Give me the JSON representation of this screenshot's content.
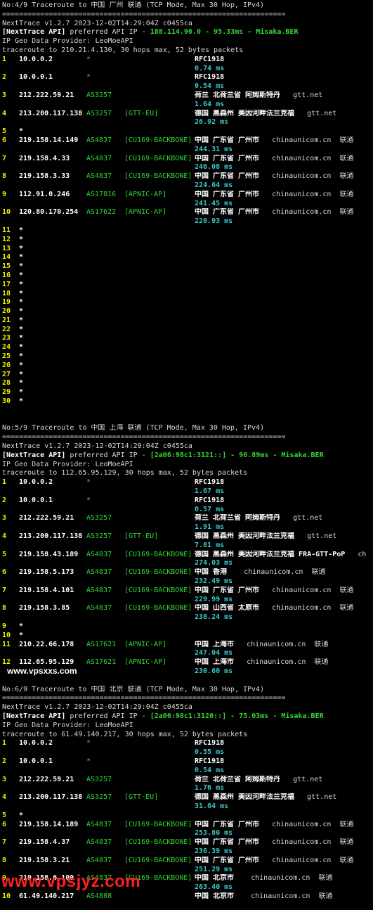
{
  "watermark_top": "www.vpsxxs.com",
  "watermark_bottom": "www.vpsjyz.com",
  "sections": [
    {
      "title": "No:4/9 Traceroute to 中国 广州 联通 (TCP Mode, Max 30 Hop, IPv4)",
      "separator": "===================================================================",
      "version": "NextTrace v1.2.7 2023-12-02T14:29:04Z c0455ca",
      "api_prefix": "[NextTrace API]",
      "api_mid": " preferred API IP - ",
      "api_ip": "188.114.96.0",
      "api_rtt": " - 95.33ms - ",
      "api_node": "Misaka.BER",
      "geo_provider": "IP Geo Data Provider: LeoMoeAPI",
      "trace_line": "traceroute to 210.21.4.130, 30 hops max, 52 bytes packets",
      "hops": [
        {
          "n": "1",
          "ip": "10.0.0.2",
          "as": "*",
          "tag": "",
          "geo": "RFC1918",
          "dom": "",
          "rtt": "0.74 ms"
        },
        {
          "n": "2",
          "ip": "10.0.0.1",
          "as": "*",
          "tag": "",
          "geo": "RFC1918",
          "dom": "",
          "rtt": "0.54 ms"
        },
        {
          "n": "3",
          "ip": "212.222.59.21",
          "as": "AS3257",
          "tag": "",
          "geo": "荷兰 北荷兰省 阿姆斯特丹",
          "dom": "gtt.net",
          "rtt": "1.64 ms"
        },
        {
          "n": "4",
          "ip": "213.200.117.138",
          "as": "AS3257",
          "tag": "[GTT-EU]",
          "geo": "德国 黑森州 美因河畔法兰克福",
          "dom": "gtt.net",
          "rtt": "26.92 ms"
        },
        {
          "n": "5",
          "ip": "*",
          "as": "",
          "tag": "",
          "geo": "",
          "dom": "",
          "rtt": ""
        },
        {
          "n": "6",
          "ip": "219.158.14.149",
          "as": "AS4837",
          "tag": "[CU169-BACKBONE]",
          "geo": "中国 广东省 广州市",
          "dom": "chinaunicom.cn  联通",
          "rtt": "244.31 ms"
        },
        {
          "n": "7",
          "ip": "219.158.4.33",
          "as": "AS4837",
          "tag": "[CU169-BACKBONE]",
          "geo": "中国 广东省 广州市",
          "dom": "chinaunicom.cn  联通",
          "rtt": "246.08 ms"
        },
        {
          "n": "8",
          "ip": "219.158.3.33",
          "as": "AS4837",
          "tag": "[CU169-BACKBONE]",
          "geo": "中国 广东省 广州市",
          "dom": "chinaunicom.cn  联通",
          "rtt": "224.64 ms"
        },
        {
          "n": "9",
          "ip": "112.91.0.246",
          "as": "AS17816",
          "tag": "[APNIC-AP]",
          "geo": "中国 广东省 广州市",
          "dom": "chinaunicom.cn  联通",
          "rtt": "241.45 ms"
        },
        {
          "n": "10",
          "ip": "120.80.170.254",
          "as": "AS17622",
          "tag": "[APNIC-AP]",
          "geo": "中国 广东省 广州市",
          "dom": "chinaunicom.cn  联通",
          "rtt": "220.93 ms"
        }
      ],
      "star_hops": [
        "11",
        "12",
        "13",
        "14",
        "15",
        "16",
        "17",
        "18",
        "19",
        "20",
        "21",
        "22",
        "23",
        "24",
        "25",
        "26",
        "27",
        "28",
        "29",
        "30"
      ]
    },
    {
      "title": "No:5/9 Traceroute to 中国 上海 联通 (TCP Mode, Max 30 Hop, IPv4)",
      "separator": "===================================================================",
      "version": "NextTrace v1.2.7 2023-12-02T14:29:04Z c0455ca",
      "api_prefix": "[NextTrace API]",
      "api_mid": " preferred API IP - ",
      "api_ip": "[2a06:98c1:3121::]",
      "api_rtt": " - 96.89ms - ",
      "api_node": "Misaka.BER",
      "geo_provider": "IP Geo Data Provider: LeoMoeAPI",
      "trace_line": "traceroute to 112.65.95.129, 30 hops max, 52 bytes packets",
      "hops": [
        {
          "n": "1",
          "ip": "10.0.0.2",
          "as": "*",
          "tag": "",
          "geo": "RFC1918",
          "dom": "",
          "rtt": "1.67 ms"
        },
        {
          "n": "2",
          "ip": "10.0.0.1",
          "as": "*",
          "tag": "",
          "geo": "RFC1918",
          "dom": "",
          "rtt": "0.57 ms"
        },
        {
          "n": "3",
          "ip": "212.222.59.21",
          "as": "AS3257",
          "tag": "",
          "geo": "荷兰 北荷兰省 阿姆斯特丹",
          "dom": "gtt.net",
          "rtt": "1.91 ms"
        },
        {
          "n": "4",
          "ip": "213.200.117.138",
          "as": "AS3257",
          "tag": "[GTT-EU]",
          "geo": "德国 黑森州 美因河畔法兰克福",
          "dom": "gtt.net",
          "rtt": "7.81 ms"
        },
        {
          "n": "5",
          "ip": "219.158.43.189",
          "as": "AS4837",
          "tag": "[CU169-BACKBONE]",
          "geo": "德国 黑森州 美因河畔法兰克福 FRA-GTT-PoP",
          "dom": "ch",
          "rtt": "274.03 ms"
        },
        {
          "n": "6",
          "ip": "219.158.5.173",
          "as": "AS4837",
          "tag": "[CU169-BACKBONE]",
          "geo": "中国 香港",
          "dom": " chinaunicom.cn  联通",
          "rtt": "232.49 ms"
        },
        {
          "n": "7",
          "ip": "219.158.4.101",
          "as": "AS4837",
          "tag": "[CU169-BACKBONE]",
          "geo": "中国 广东省 广州市",
          "dom": "chinaunicom.cn  联通",
          "rtt": "229.99 ms"
        },
        {
          "n": "8",
          "ip": "219.158.3.85",
          "as": "AS4837",
          "tag": "[CU169-BACKBONE]",
          "geo": "中国 山西省 太原市",
          "dom": "chinaunicom.cn  联通",
          "rtt": "238.24 ms"
        },
        {
          "n": "9",
          "ip": "*",
          "as": "",
          "tag": "",
          "geo": "",
          "dom": "",
          "rtt": ""
        },
        {
          "n": "10",
          "ip": "*",
          "as": "",
          "tag": "",
          "geo": "",
          "dom": "",
          "rtt": ""
        },
        {
          "n": "11",
          "ip": "210.22.66.178",
          "as": "AS17621",
          "tag": "[APNIC-AP]",
          "geo": "中国 上海市",
          "dom": "chinaunicom.cn  联通",
          "rtt": "247.04 ms"
        },
        {
          "n": "12",
          "ip": "112.65.95.129",
          "as": "AS17621",
          "tag": "[APNIC-AP]",
          "geo": "中国 上海市",
          "dom": "chinaunicom.cn  联通",
          "rtt": "230.60 ms"
        }
      ],
      "star_hops": []
    },
    {
      "title": "No:6/9 Traceroute to 中国 北京 联通 (TCP Mode, Max 30 Hop, IPv4)",
      "separator": "===================================================================",
      "version": "NextTrace v1.2.7 2023-12-02T14:29:04Z c0455ca",
      "api_prefix": "[NextTrace API]",
      "api_mid": " preferred API IP - ",
      "api_ip": "[2a06:98c1:3120::]",
      "api_rtt": " - 75.03ms - ",
      "api_node": "Misaka.BER",
      "geo_provider": "IP Geo Data Provider: LeoMoeAPI",
      "trace_line": "traceroute to 61.49.140.217, 30 hops max, 52 bytes packets",
      "hops": [
        {
          "n": "1",
          "ip": "10.0.0.2",
          "as": "*",
          "tag": "",
          "geo": "RFC1918",
          "dom": "",
          "rtt": "0.55 ms"
        },
        {
          "n": "2",
          "ip": "10.0.0.1",
          "as": "*",
          "tag": "",
          "geo": "RFC1918",
          "dom": "",
          "rtt": "0.54 ms"
        },
        {
          "n": "3",
          "ip": "212.222.59.21",
          "as": "AS3257",
          "tag": "",
          "geo": "荷兰 北荷兰省 阿姆斯特丹",
          "dom": "gtt.net",
          "rtt": "1.76 ms"
        },
        {
          "n": "4",
          "ip": "213.200.117.138",
          "as": "AS3257",
          "tag": "[GTT-EU]",
          "geo": "德国 黑森州 美因河畔法兰克福",
          "dom": "gtt.net",
          "rtt": "31.64 ms"
        },
        {
          "n": "5",
          "ip": "*",
          "as": "",
          "tag": "",
          "geo": "",
          "dom": "",
          "rtt": ""
        },
        {
          "n": "6",
          "ip": "219.158.14.189",
          "as": "AS4837",
          "tag": "[CU169-BACKBONE]",
          "geo": "中国 广东省 广州市",
          "dom": "chinaunicom.cn  联通",
          "rtt": "253.80 ms"
        },
        {
          "n": "7",
          "ip": "219.158.4.37",
          "as": "AS4837",
          "tag": "[CU169-BACKBONE]",
          "geo": "中国 广东省 广州市",
          "dom": "chinaunicom.cn  联通",
          "rtt": "236.39 ms"
        },
        {
          "n": "8",
          "ip": "219.158.3.21",
          "as": "AS4837",
          "tag": "[CU169-BACKBONE]",
          "geo": "中国 广东省 广州市",
          "dom": "chinaunicom.cn  联通",
          "rtt": "251.29 ms"
        },
        {
          "n": "9",
          "ip": "219.158.6.109",
          "as": "AS4837",
          "tag": "[CU169-BACKBONE]",
          "geo": "中国 北京市",
          "dom": " chinaunicom.cn  联通",
          "rtt": "263.40 ms"
        },
        {
          "n": "10",
          "ip": "61.49.140.217",
          "as": "AS4808",
          "tag": "",
          "geo": "中国 北京市",
          "dom": " chinaunicom.cn  联通",
          "rtt": ""
        }
      ],
      "star_hops": []
    }
  ]
}
